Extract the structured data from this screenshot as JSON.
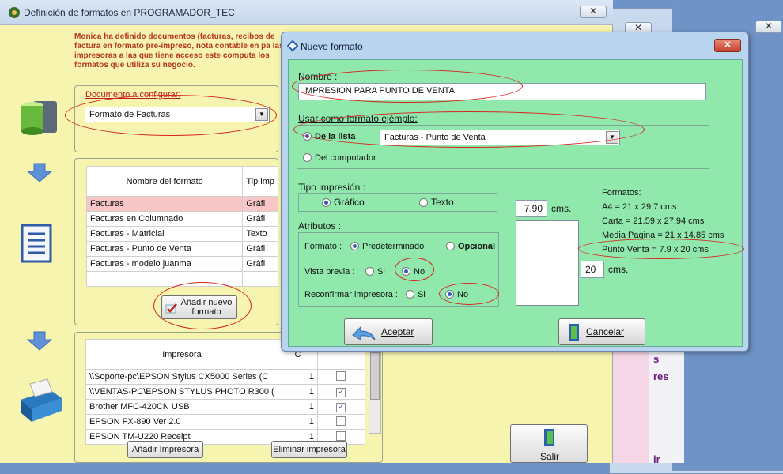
{
  "main": {
    "title": "Definición de formatos en PROGRAMADOR_TEC",
    "intro": "Monica ha definido documentos (facturas, recibos de factura en formato pre-impreso, nota contable en pa las impresoras a las que tiene acceso este computa los formatos que utiliza su negocio.",
    "doc_label": "Documento a configurar:",
    "doc_value": "Formato de Facturas",
    "formats_header_name": "Nombre del formato",
    "formats_header_type": "Tip imp",
    "formats": [
      {
        "name": "Facturas",
        "type": "Gráfi"
      },
      {
        "name": "Facturas en Columnado",
        "type": "Gráfi"
      },
      {
        "name": "Facturas - Matricial",
        "type": "Texto"
      },
      {
        "name": "Facturas - Punto de Venta",
        "type": "Gráfi"
      },
      {
        "name": "Facturas - modelo juanma",
        "type": "Gráfi"
      }
    ],
    "add_format_label": "Añadir nuevo formato",
    "printers_header_name": "Impresora",
    "printers_header_c": "C",
    "printers": [
      {
        "name": "\\\\Soporte-pc\\EPSON Stylus CX5000 Series (C",
        "copies": "1",
        "checked": false
      },
      {
        "name": "\\\\VENTAS-PC\\EPSON STYLUS PHOTO R300 (",
        "copies": "1",
        "checked": true
      },
      {
        "name": "Brother MFC-420CN USB",
        "copies": "1",
        "checked": true
      },
      {
        "name": "EPSON FX-890 Ver 2.0",
        "copies": "1",
        "checked": false
      },
      {
        "name": "EPSON TM-U220 Receipt",
        "copies": "1",
        "checked": false
      }
    ],
    "add_printer_label": "Añadir Impresora",
    "remove_printer_label": "Eliminar impresora",
    "exit_label": "Salir",
    "partial_text_1": "s",
    "partial_text_2": "res",
    "partial_text_3": "ir",
    "close_glyph": "✕"
  },
  "dialog": {
    "title": "Nuevo formato",
    "close_glyph": "✕",
    "name_label": "Nombre :",
    "name_value": "IMPRESION PARA PUNTO DE VENTA",
    "sample_label": "Usar como formato ejémplo:",
    "from_list_label": "De la lista",
    "from_list_value": "Facturas - Punto de Venta",
    "from_computer_label": "Del computador",
    "print_type_label": "Tipo impresión :",
    "graphic_label": "Gráfico",
    "text_label": "Texto",
    "attributes_label": "Atributos :",
    "format_label": "Formato :",
    "predetermined_label": "Predeterminado",
    "optional_label": "Opcional",
    "preview_label": "Vista previa :",
    "reconfirm_label": "Reconfirmar impresora :",
    "yes_label": "Si",
    "no_label": "No",
    "width_value": "7.90",
    "width_unit": "cms.",
    "height_value": "20",
    "height_unit": "cms.",
    "formats_title": "Formatos:",
    "format_a4": "A4 = 21 x 29.7 cms",
    "format_carta": "Carta = 21.59 x 27.94 cms",
    "format_media": "Media Pagina =  21 x  14.85 cms",
    "format_punto": "Punto Venta =  7.9 x  20 cms",
    "accept_label": "Aceptar",
    "cancel_label": "Cancelar"
  }
}
